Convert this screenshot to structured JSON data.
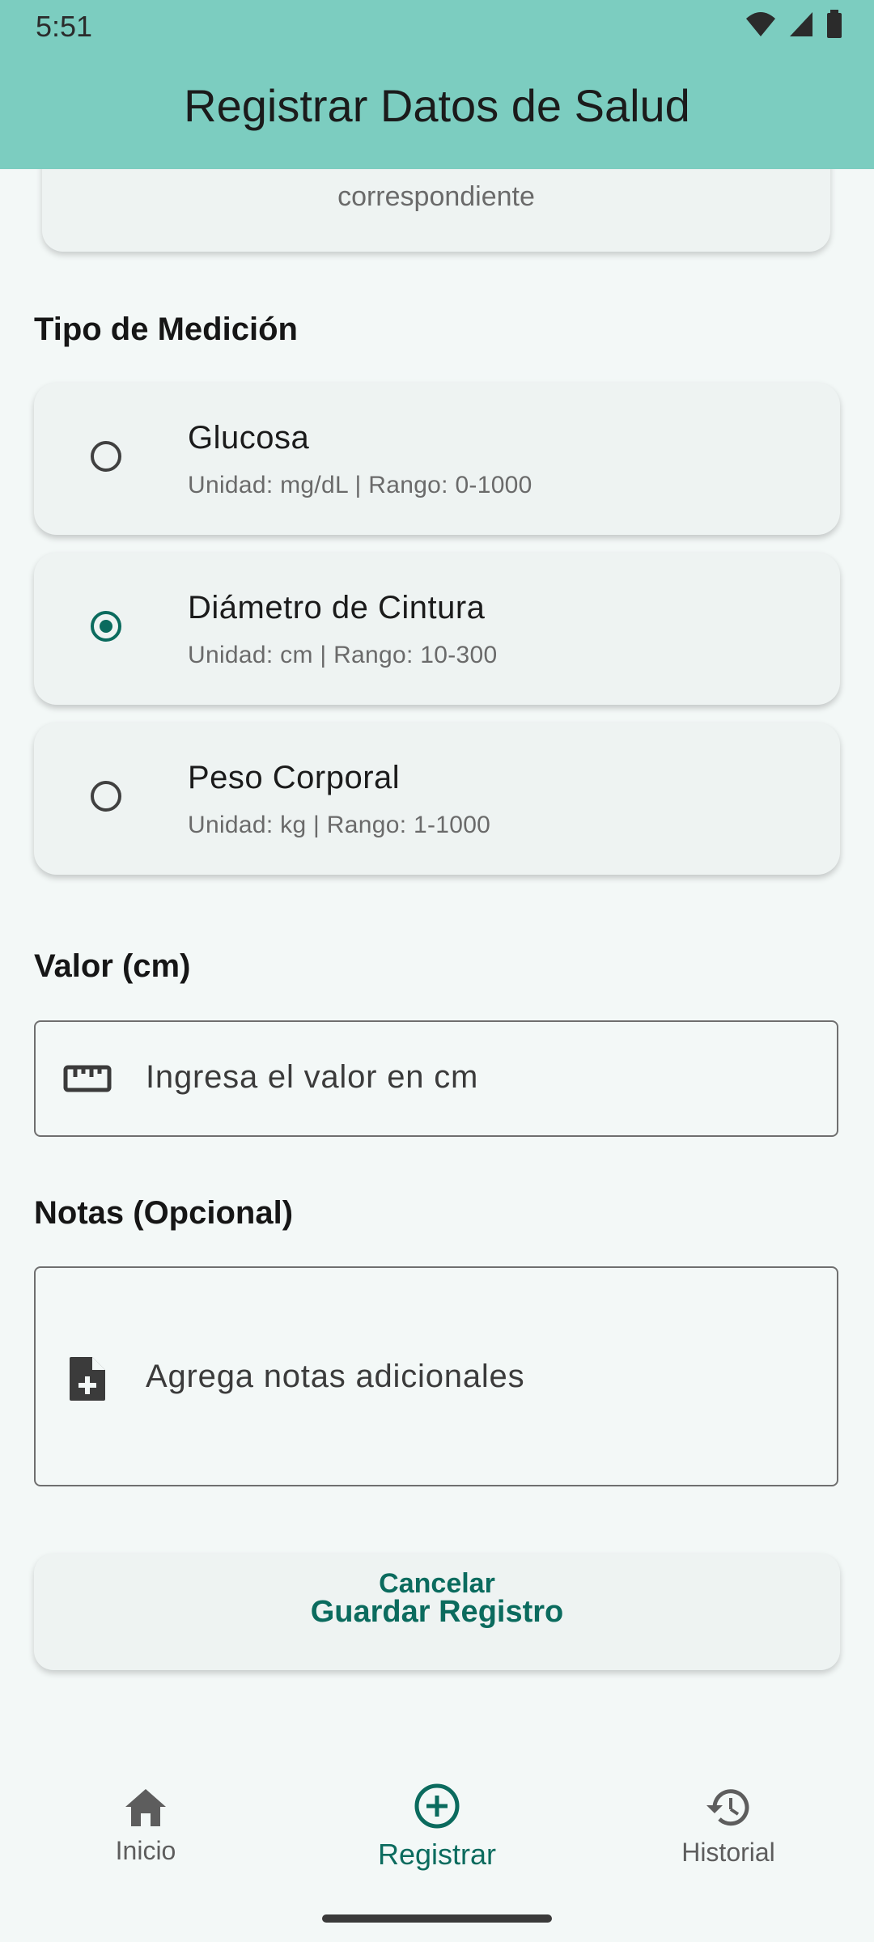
{
  "status_bar": {
    "time": "5:51"
  },
  "app_bar": {
    "title": "Registrar Datos de Salud"
  },
  "previous_card": {
    "text": "correspondiente"
  },
  "measurement": {
    "label": "Tipo de Medición",
    "options": [
      {
        "name": "Glucosa",
        "detail": "Unidad: mg/dL | Rango: 0-1000",
        "selected": false
      },
      {
        "name": "Diámetro de Cintura",
        "detail": "Unidad: cm | Rango: 10-300",
        "selected": true
      },
      {
        "name": "Peso Corporal",
        "detail": "Unidad: kg | Rango: 1-1000",
        "selected": false
      }
    ]
  },
  "value_field": {
    "label": "Valor (cm)",
    "placeholder": "Ingresa el valor en cm",
    "icon": "ruler-icon"
  },
  "notes_field": {
    "label": "Notas (Opcional)",
    "placeholder": "Agrega notas adicionales",
    "icon": "note-add-icon"
  },
  "actions": {
    "save_label": "Guardar Registro",
    "cancel_label": "Cancelar"
  },
  "bottom_nav": {
    "items": [
      {
        "label": "Inicio",
        "icon": "home-icon",
        "active": false
      },
      {
        "label": "Registrar",
        "icon": "add-circle-icon",
        "active": true
      },
      {
        "label": "Historial",
        "icon": "history-icon",
        "active": false
      }
    ]
  },
  "colors": {
    "app_bar": "#7ccdc0",
    "accent": "#0b6b5e",
    "background": "#f3f8f7",
    "card": "#eef3f2"
  }
}
